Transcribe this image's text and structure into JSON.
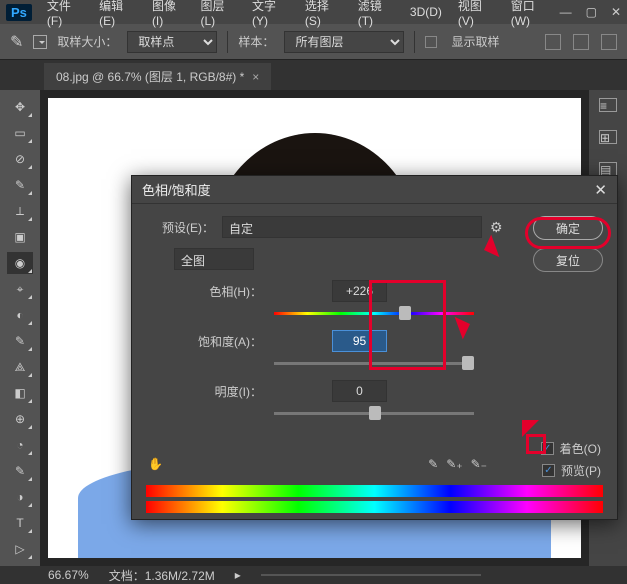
{
  "menu": {
    "ps": "Ps",
    "items": [
      "文件(F)",
      "编辑(E)",
      "图像(I)",
      "图层(L)",
      "文字(Y)",
      "选择(S)",
      "滤镜(T)",
      "3D(D)",
      "视图(V)",
      "窗口(W)"
    ]
  },
  "options": {
    "sample_size_label": "取样大小：",
    "sample_size_value": "取样点",
    "sample_label": "样本：",
    "sample_value": "所有图层",
    "show_ring": "显示取样"
  },
  "tab": {
    "title": "08.jpg @ 66.7% (图层 1, RGB/8#) *"
  },
  "status": {
    "zoom": "66.67%",
    "doc": "文档：1.36M/2.72M"
  },
  "dialog": {
    "title": "色相/饱和度",
    "preset_label": "预设(E)：",
    "preset_value": "自定",
    "channel": "全图",
    "hue_label": "色相(H)：",
    "hue_value": "+226",
    "sat_label": "饱和度(A)：",
    "sat_value": "95",
    "light_label": "明度(I)：",
    "light_value": "0",
    "ok": "确定",
    "reset": "复位",
    "colorize": "着色(O)",
    "preview": "预览(P)"
  },
  "tool_icons": [
    "✥",
    "▭",
    "⊘",
    "✎",
    "⟂",
    "▣",
    "◉",
    "⌖",
    "◐",
    "✎",
    "⟁",
    "◧",
    "⊕",
    "◔",
    "✎",
    "◑",
    "▮",
    "T",
    "▷"
  ],
  "right_icons": [
    "≡",
    "⊞",
    "▤",
    "fx"
  ]
}
